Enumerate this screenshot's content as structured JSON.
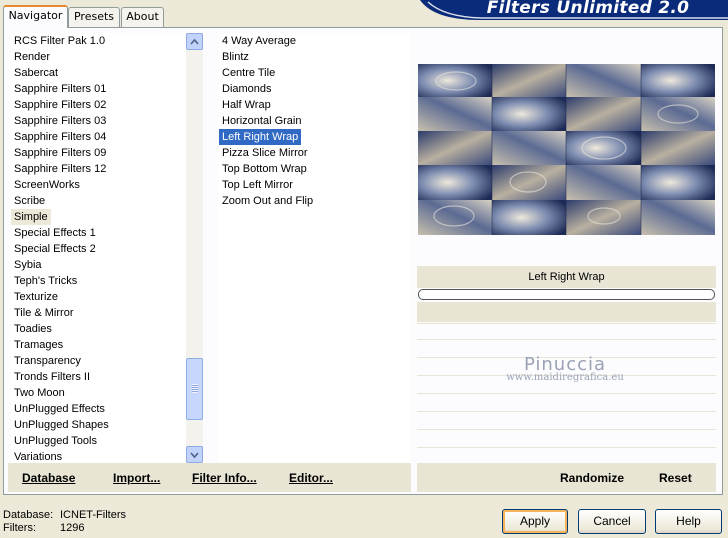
{
  "tabs": [
    {
      "label": "Navigator"
    },
    {
      "label": "Presets"
    },
    {
      "label": "About"
    }
  ],
  "brand_title": "Filters Unlimited 2.0",
  "categories": [
    "RCS Filter Pak 1.0",
    "Render",
    "Sabercat",
    "Sapphire Filters 01",
    "Sapphire Filters 02",
    "Sapphire Filters 03",
    "Sapphire Filters 04",
    "Sapphire Filters 09",
    "Sapphire Filters 12",
    "ScreenWorks",
    "Scribe",
    "Simple",
    "Special Effects 1",
    "Special Effects 2",
    "Sybia",
    "Teph's Tricks",
    "Texturize",
    "Tile & Mirror",
    "Toadies",
    "Tramages",
    "Transparency",
    "Tronds Filters II",
    "Two Moon",
    "UnPlugged Effects",
    "UnPlugged Shapes",
    "UnPlugged Tools",
    "Variations"
  ],
  "selected_category": "Simple",
  "filters": [
    "4 Way Average",
    "Blintz",
    "Centre Tile",
    "Diamonds",
    "Half Wrap",
    "Horizontal Grain",
    "Left Right Wrap",
    "Pizza Slice Mirror",
    "Top Bottom Wrap",
    "Top Left Mirror",
    "Zoom Out and Flip"
  ],
  "selected_filter": "Left Right Wrap",
  "left_actions": {
    "database": "Database",
    "import": "Import...",
    "filter_info": "Filter Info...",
    "editor": "Editor..."
  },
  "right_actions": {
    "randomize": "Randomize",
    "reset": "Reset"
  },
  "preview_label": "Left Right Wrap",
  "watermark": {
    "line1": "Pinuccia",
    "line2": "www.maidiregrafica.eu"
  },
  "status": {
    "database_label": "Database:",
    "database_value": "ICNET-Filters",
    "filters_label": "Filters:",
    "filters_value": "1296"
  },
  "buttons": {
    "apply": "Apply",
    "cancel": "Cancel",
    "help": "Help"
  },
  "colors": {
    "accent_orange": "#e68b2c",
    "selection_blue": "#316ac5",
    "brand_navy": "#0a2a7a"
  }
}
